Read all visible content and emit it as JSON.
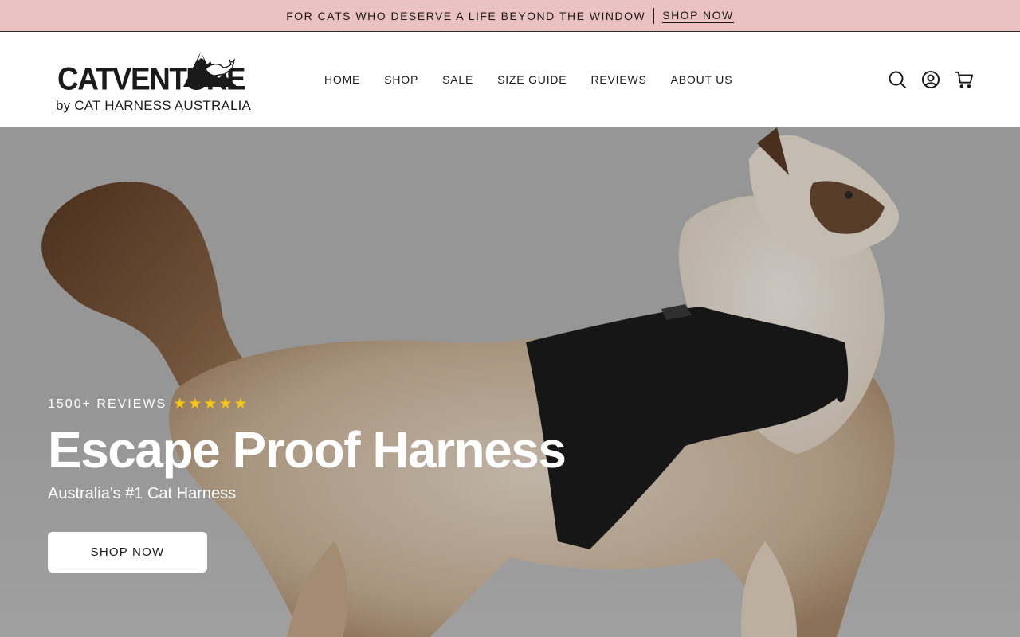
{
  "announcement": {
    "text": "FOR CATS WHO DESERVE A LIFE BEYOND THE WINDOW",
    "link_label": "SHOP NOW"
  },
  "header": {
    "logo": {
      "wordmark": "CATVENTURE",
      "tagline": "by CAT HARNESS AUSTRALIA"
    },
    "nav": [
      {
        "label": "HOME"
      },
      {
        "label": "SHOP"
      },
      {
        "label": "SALE"
      },
      {
        "label": "SIZE GUIDE"
      },
      {
        "label": "REVIEWS"
      },
      {
        "label": "ABOUT US"
      }
    ],
    "icons": [
      "search-icon",
      "account-icon",
      "cart-icon"
    ]
  },
  "hero": {
    "reviews_label": "1500+ REVIEWS",
    "rating_stars": 5,
    "title": "Escape Proof Harness",
    "subtitle": "Australia's #1 Cat Harness",
    "button_label": "SHOP NOW"
  },
  "colors": {
    "announcement_bg": "#ebc2c2",
    "star": "#f5c518",
    "text_dark": "#1a1a1a"
  }
}
